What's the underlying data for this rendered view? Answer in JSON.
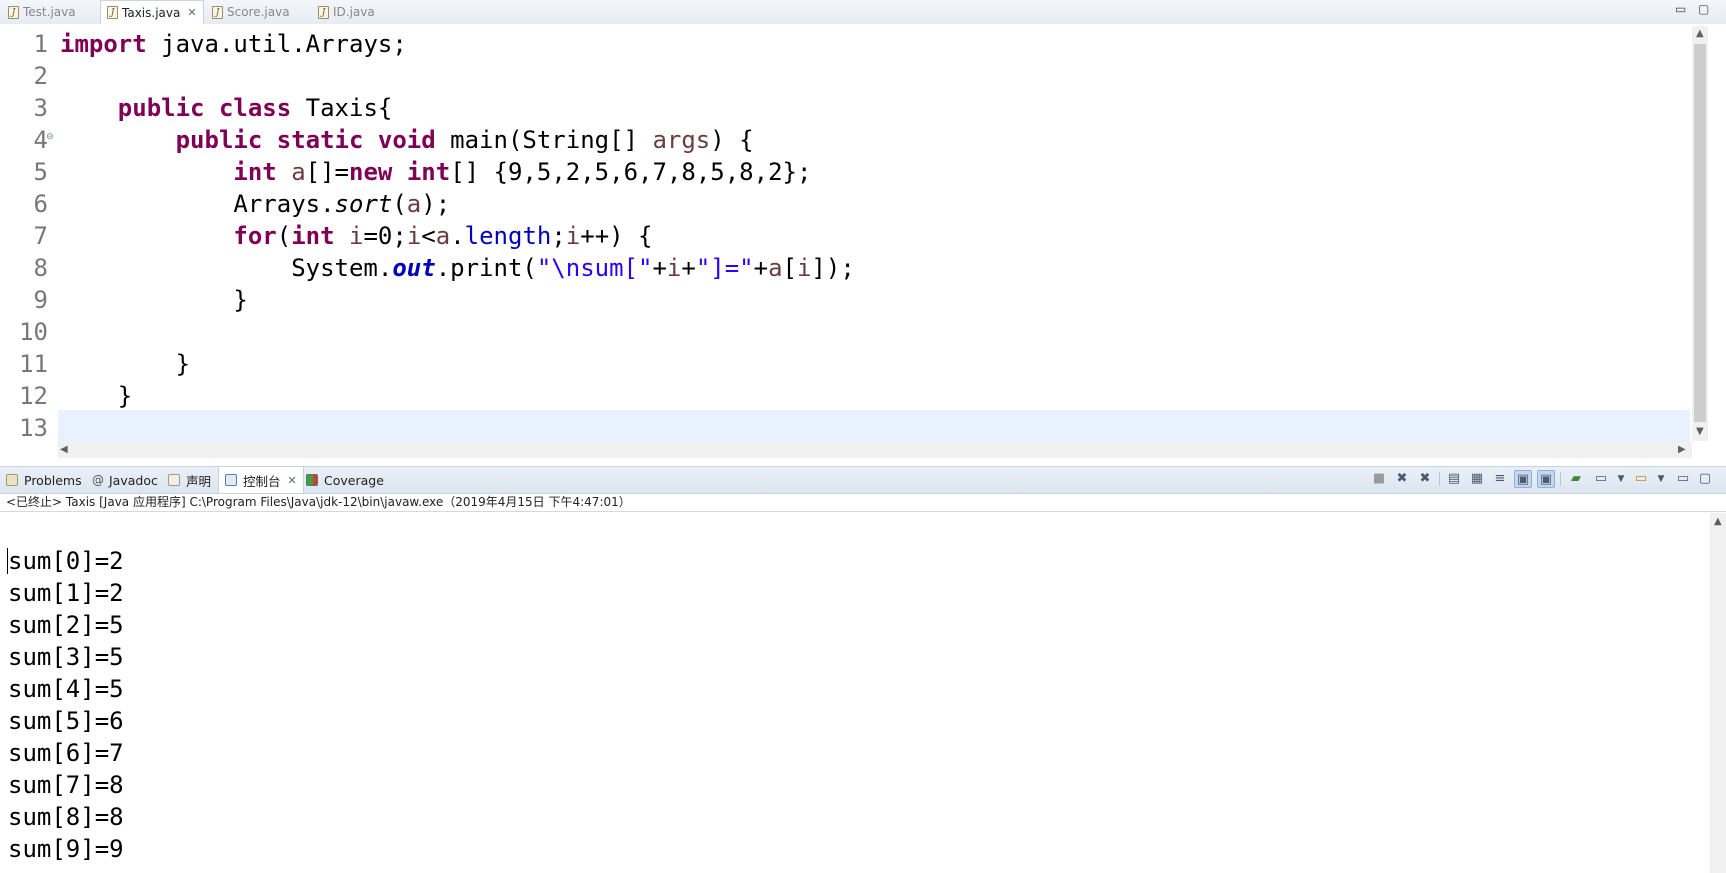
{
  "editor_tabs": [
    {
      "label": "Test.java",
      "active": false
    },
    {
      "label": "Taxis.java",
      "active": true
    },
    {
      "label": "Score.java",
      "active": false
    },
    {
      "label": "ID.java",
      "active": false
    }
  ],
  "window_controls": {
    "minimize": "▭",
    "maximize": "▢"
  },
  "line_numbers": [
    "1",
    "2",
    "3",
    "4",
    "5",
    "6",
    "7",
    "8",
    "9",
    "10",
    "11",
    "12",
    "13"
  ],
  "code": {
    "l1": {
      "kw": "import",
      "rest": " java.util.Arrays;"
    },
    "l3": {
      "indent": "    ",
      "kw1": "public",
      "kw2": "class",
      "rest": " Taxis{"
    },
    "l4": {
      "indent": "        ",
      "kw1": "public",
      "kw2": "static",
      "kw3": "void",
      "rest1": " main(String[] ",
      "param": "args",
      "rest2": ") {"
    },
    "l5": {
      "indent": "            ",
      "kw1": "int",
      "var": "a",
      "mid": "[]=",
      "kw2": "new",
      "kw3": "int",
      "rest": "[] {9,5,2,5,6,7,8,5,8,2};"
    },
    "l6": {
      "indent": "            ",
      "cls": "Arrays.",
      "method": "sort",
      "open": "(",
      "var": "a",
      "close": ");"
    },
    "l7": {
      "indent": "            ",
      "kw1": "for",
      "p1": "(",
      "kw2": "int",
      "v1": " i",
      "p2": "=0;",
      "v2": "i",
      "p3": "<",
      "v3": "a",
      "p4": ".",
      "fld": "length",
      "p5": ";",
      "v4": "i",
      "p6": "++) {"
    },
    "l8": {
      "indent": "                ",
      "cls": "System.",
      "sfld": "out",
      "call": ".print(",
      "s1": "\"\\nsum[\"",
      "p1": "+",
      "v1": "i",
      "p2": "+",
      "s2": "\"]=\"",
      "p3": "+",
      "v2": "a",
      "p4": "[",
      "v3": "i",
      "p5": "]);"
    },
    "l9": {
      "text": "            }"
    },
    "l11": {
      "text": "        }"
    },
    "l12": {
      "text": "    }"
    }
  },
  "view_tabs": [
    {
      "label": "Problems",
      "icon": "problems-icon",
      "active": false
    },
    {
      "label": "Javadoc",
      "icon": "javadoc-icon",
      "active": false
    },
    {
      "label": "声明",
      "icon": "declaration-icon",
      "active": false
    },
    {
      "label": "控制台",
      "icon": "console-icon",
      "active": true
    },
    {
      "label": "Coverage",
      "icon": "coverage-icon",
      "active": false
    }
  ],
  "console_header": "<已终止> Taxis [Java 应用程序] C:\\Program Files\\Java\\jdk-12\\bin\\javaw.exe（2019年4月15日 下午4:47:01）",
  "console_output": [
    "sum[0]=2",
    "sum[1]=2",
    "sum[2]=5",
    "sum[3]=5",
    "sum[4]=5",
    "sum[5]=6",
    "sum[6]=7",
    "sum[7]=8",
    "sum[8]=8",
    "sum[9]=9"
  ],
  "colors": {
    "keyword": "#7f0055",
    "string": "#2a00ff",
    "field": "#0000c0",
    "local_var": "#6a3e3e",
    "current_line": "#e8f2fe"
  }
}
